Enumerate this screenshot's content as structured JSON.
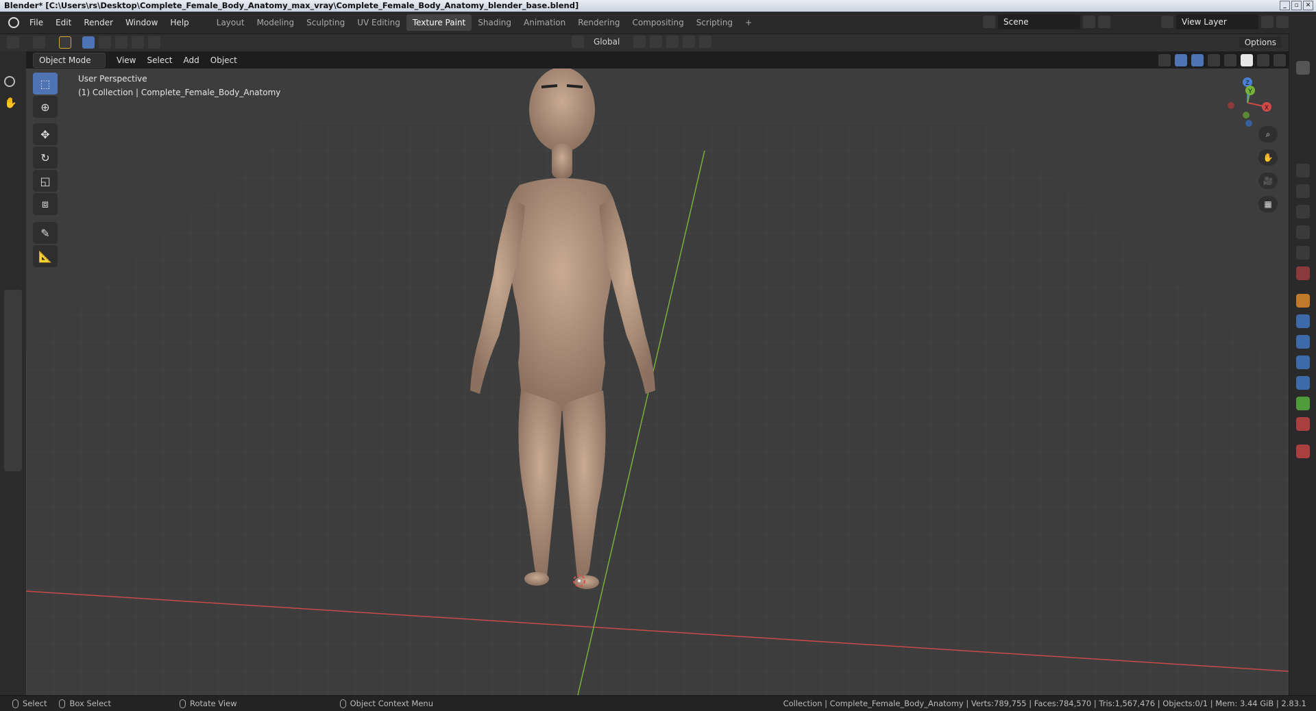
{
  "window": {
    "title": "Blender* [C:\\Users\\rs\\Desktop\\Complete_Female_Body_Anatomy_max_vray\\Complete_Female_Body_Anatomy_blender_base.blend]",
    "buttons": [
      "_",
      "▫",
      "✕"
    ]
  },
  "menu": [
    "File",
    "Edit",
    "Render",
    "Window",
    "Help"
  ],
  "workspaces": [
    "Layout",
    "Modeling",
    "Sculpting",
    "UV Editing",
    "Texture Paint",
    "Shading",
    "Animation",
    "Rendering",
    "Compositing",
    "Scripting"
  ],
  "active_workspace": "Texture Paint",
  "add_workspace": "+",
  "scene": {
    "name": "Scene",
    "view_layer": "View Layer"
  },
  "tool_header": {
    "orientation": "Global",
    "options": "Options"
  },
  "viewport_header": {
    "mode": "Object Mode",
    "items": [
      "View",
      "Select",
      "Add",
      "Object"
    ]
  },
  "viewport_overlay": {
    "line1": "User Perspective",
    "line2": "(1) Collection | Complete_Female_Body_Anatomy"
  },
  "axis_labels": {
    "x": "X",
    "y": "Y",
    "z": "Z"
  },
  "status": {
    "select": "Select",
    "box_select": "Box Select",
    "rotate": "Rotate View",
    "context": "Object Context Menu",
    "stats": "Collection | Complete_Female_Body_Anatomy | Verts:789,755 | Faces:784,570 | Tris:1,567,476 | Objects:0/1 | Mem: 3.44 GiB | 2.83.1"
  },
  "colors": {
    "viewport_bg": "#3d3d3d",
    "x_axis": "#c84a4a",
    "y_axis": "#74b23a",
    "active_tool": "#4f74b4",
    "skin": "#b79880"
  },
  "icons": {
    "tools": [
      "select-box-icon",
      "cursor-icon",
      "move-icon",
      "rotate-icon",
      "scale-icon",
      "transform-icon",
      "annotate-icon",
      "measure-icon"
    ],
    "nav": [
      "zoom-icon",
      "pan-hand-icon",
      "camera-icon",
      "ortho-grid-icon"
    ]
  }
}
